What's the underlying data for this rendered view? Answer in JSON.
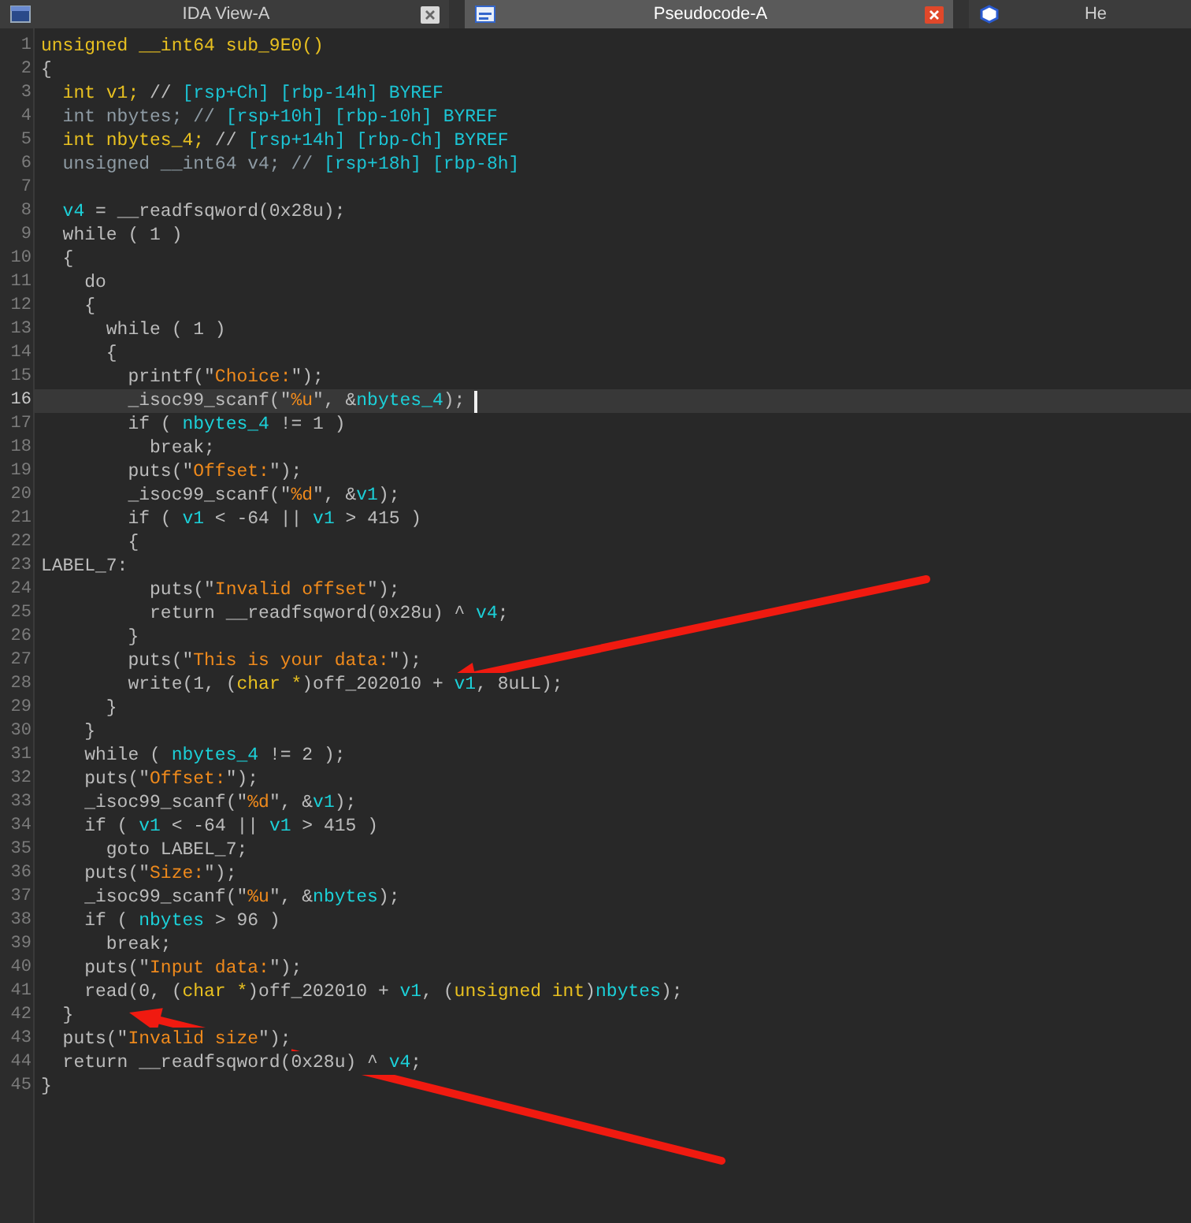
{
  "tabs": [
    {
      "label": "IDA View-A",
      "kind": "disasm",
      "selected": false,
      "closable": true
    },
    {
      "label": "Pseudocode-A",
      "kind": "pseudocode",
      "selected": true,
      "closable": true
    },
    {
      "label": "He",
      "kind": "hex",
      "selected": false,
      "closable": false
    }
  ],
  "code_lines": [
    {
      "number": "1",
      "current": false,
      "tokens": [
        {
          "kind": "type",
          "text": "unsigned __int64 sub_9E0()"
        }
      ]
    },
    {
      "number": "2",
      "current": false,
      "tokens": [
        {
          "kind": "plain",
          "text": "{"
        }
      ]
    },
    {
      "number": "3",
      "current": false,
      "tokens": [
        {
          "kind": "type",
          "text": "  int v1;"
        },
        {
          "kind": "plain",
          "text": " // "
        },
        {
          "kind": "comment",
          "text": "[rsp+Ch] [rbp-14h] BYREF"
        }
      ]
    },
    {
      "number": "4",
      "current": false,
      "tokens": [
        {
          "kind": "dim",
          "text": "  int nbytes; // "
        },
        {
          "kind": "comment",
          "text": "[rsp+10h] [rbp-10h] BYREF"
        }
      ]
    },
    {
      "number": "5",
      "current": false,
      "tokens": [
        {
          "kind": "type",
          "text": "  int nbytes_4;"
        },
        {
          "kind": "plain",
          "text": " // "
        },
        {
          "kind": "comment",
          "text": "[rsp+14h] [rbp-Ch] BYREF"
        }
      ]
    },
    {
      "number": "6",
      "current": false,
      "tokens": [
        {
          "kind": "dim",
          "text": "  unsigned __int64 v4; // "
        },
        {
          "kind": "comment",
          "text": "[rsp+18h] [rbp-8h]"
        }
      ]
    },
    {
      "number": "7",
      "current": false
    },
    {
      "number": "8",
      "current": false,
      "tokens": [
        {
          "kind": "var",
          "text": "  v4"
        },
        {
          "kind": "plain",
          "text": " = __readfsqword(0x28u);"
        }
      ]
    },
    {
      "number": "9",
      "current": false,
      "tokens": [
        {
          "kind": "plain",
          "text": "  while ( 1 )"
        }
      ]
    },
    {
      "number": "10",
      "current": false,
      "tokens": [
        {
          "kind": "plain",
          "text": "  {"
        }
      ]
    },
    {
      "number": "11",
      "current": false,
      "tokens": [
        {
          "kind": "plain",
          "text": "    do"
        }
      ]
    },
    {
      "number": "12",
      "current": false,
      "tokens": [
        {
          "kind": "plain",
          "text": "    {"
        }
      ]
    },
    {
      "number": "13",
      "current": false,
      "tokens": [
        {
          "kind": "plain",
          "text": "      while ( 1 )"
        }
      ]
    },
    {
      "number": "14",
      "current": false,
      "tokens": [
        {
          "kind": "plain",
          "text": "      {"
        }
      ]
    },
    {
      "number": "15",
      "current": false,
      "tokens": [
        {
          "kind": "plain",
          "text": "        printf(\""
        },
        {
          "kind": "string",
          "text": "Choice:"
        },
        {
          "kind": "plain",
          "text": "\");"
        }
      ]
    },
    {
      "number": "16",
      "current": true,
      "tokens": [
        {
          "kind": "plain",
          "text": "        _isoc99_scanf(\""
        },
        {
          "kind": "string",
          "text": "%u"
        },
        {
          "kind": "plain",
          "text": "\", &"
        },
        {
          "kind": "var",
          "text": "nbytes_4"
        },
        {
          "kind": "plain",
          "text": ");"
        }
      ]
    },
    {
      "number": "17",
      "current": false,
      "tokens": [
        {
          "kind": "plain",
          "text": "        if ( "
        },
        {
          "kind": "var",
          "text": "nbytes_4"
        },
        {
          "kind": "plain",
          "text": " != 1 )"
        }
      ]
    },
    {
      "number": "18",
      "current": false,
      "tokens": [
        {
          "kind": "plain",
          "text": "          break;"
        }
      ]
    },
    {
      "number": "19",
      "current": false,
      "tokens": [
        {
          "kind": "plain",
          "text": "        puts(\""
        },
        {
          "kind": "string",
          "text": "Offset:"
        },
        {
          "kind": "plain",
          "text": "\");"
        }
      ]
    },
    {
      "number": "20",
      "current": false,
      "tokens": [
        {
          "kind": "plain",
          "text": "        _isoc99_scanf(\""
        },
        {
          "kind": "string",
          "text": "%d"
        },
        {
          "kind": "plain",
          "text": "\", &"
        },
        {
          "kind": "var",
          "text": "v1"
        },
        {
          "kind": "plain",
          "text": ");"
        }
      ]
    },
    {
      "number": "21",
      "current": false,
      "tokens": [
        {
          "kind": "plain",
          "text": "        if ( "
        },
        {
          "kind": "var",
          "text": "v1"
        },
        {
          "kind": "plain",
          "text": " < -64 || "
        },
        {
          "kind": "var",
          "text": "v1"
        },
        {
          "kind": "plain",
          "text": " > 415 )"
        }
      ]
    },
    {
      "number": "22",
      "current": false,
      "tokens": [
        {
          "kind": "plain",
          "text": "        {"
        }
      ]
    },
    {
      "number": "23",
      "current": false,
      "tokens": [
        {
          "kind": "plain",
          "text": "LABEL_7:"
        }
      ]
    },
    {
      "number": "24",
      "current": false,
      "tokens": [
        {
          "kind": "plain",
          "text": "          puts(\""
        },
        {
          "kind": "string",
          "text": "Invalid offset"
        },
        {
          "kind": "plain",
          "text": "\");"
        }
      ]
    },
    {
      "number": "25",
      "current": false,
      "tokens": [
        {
          "kind": "plain",
          "text": "          return __readfsqword(0x28u) ^ "
        },
        {
          "kind": "var",
          "text": "v4"
        },
        {
          "kind": "plain",
          "text": ";"
        }
      ]
    },
    {
      "number": "26",
      "current": false,
      "tokens": [
        {
          "kind": "plain",
          "text": "        }"
        }
      ]
    },
    {
      "number": "27",
      "current": false,
      "tokens": [
        {
          "kind": "plain",
          "text": "        puts(\""
        },
        {
          "kind": "string",
          "text": "This is your data:"
        },
        {
          "kind": "plain",
          "text": "\");"
        }
      ]
    },
    {
      "number": "28",
      "current": false,
      "tokens": [
        {
          "kind": "plain",
          "text": "        write(1, ("
        },
        {
          "kind": "type",
          "text": "char *"
        },
        {
          "kind": "plain",
          "text": ")off_202010 + "
        },
        {
          "kind": "var",
          "text": "v1"
        },
        {
          "kind": "plain",
          "text": ", 8uLL);"
        }
      ]
    },
    {
      "number": "29",
      "current": false,
      "tokens": [
        {
          "kind": "plain",
          "text": "      }"
        }
      ]
    },
    {
      "number": "30",
      "current": false,
      "tokens": [
        {
          "kind": "plain",
          "text": "    }"
        }
      ]
    },
    {
      "number": "31",
      "current": false,
      "tokens": [
        {
          "kind": "plain",
          "text": "    while ( "
        },
        {
          "kind": "var",
          "text": "nbytes_4"
        },
        {
          "kind": "plain",
          "text": " != 2 );"
        }
      ]
    },
    {
      "number": "32",
      "current": false,
      "tokens": [
        {
          "kind": "plain",
          "text": "    puts(\""
        },
        {
          "kind": "string",
          "text": "Offset:"
        },
        {
          "kind": "plain",
          "text": "\");"
        }
      ]
    },
    {
      "number": "33",
      "current": false,
      "tokens": [
        {
          "kind": "plain",
          "text": "    _isoc99_scanf(\""
        },
        {
          "kind": "string",
          "text": "%d"
        },
        {
          "kind": "plain",
          "text": "\", &"
        },
        {
          "kind": "var",
          "text": "v1"
        },
        {
          "kind": "plain",
          "text": ");"
        }
      ]
    },
    {
      "number": "34",
      "current": false,
      "tokens": [
        {
          "kind": "plain",
          "text": "    if ( "
        },
        {
          "kind": "var",
          "text": "v1"
        },
        {
          "kind": "plain",
          "text": " < -64 || "
        },
        {
          "kind": "var",
          "text": "v1"
        },
        {
          "kind": "plain",
          "text": " > 415 )"
        }
      ]
    },
    {
      "number": "35",
      "current": false,
      "tokens": [
        {
          "kind": "plain",
          "text": "      goto LABEL_7;"
        }
      ]
    },
    {
      "number": "36",
      "current": false,
      "tokens": [
        {
          "kind": "plain",
          "text": "    puts(\""
        },
        {
          "kind": "string",
          "text": "Size:"
        },
        {
          "kind": "plain",
          "text": "\");"
        }
      ]
    },
    {
      "number": "37",
      "current": false,
      "tokens": [
        {
          "kind": "plain",
          "text": "    _isoc99_scanf(\""
        },
        {
          "kind": "string",
          "text": "%u"
        },
        {
          "kind": "plain",
          "text": "\", &"
        },
        {
          "kind": "var",
          "text": "nbytes"
        },
        {
          "kind": "plain",
          "text": ");"
        }
      ]
    },
    {
      "number": "38",
      "current": false,
      "tokens": [
        {
          "kind": "plain",
          "text": "    if ( "
        },
        {
          "kind": "var",
          "text": "nbytes"
        },
        {
          "kind": "plain",
          "text": " > 96 )"
        }
      ]
    },
    {
      "number": "39",
      "current": false,
      "tokens": [
        {
          "kind": "plain",
          "text": "      break;"
        }
      ]
    },
    {
      "number": "40",
      "current": false,
      "tokens": [
        {
          "kind": "plain",
          "text": "    puts(\""
        },
        {
          "kind": "string",
          "text": "Input data:"
        },
        {
          "kind": "plain",
          "text": "\");"
        }
      ]
    },
    {
      "number": "41",
      "current": false,
      "tokens": [
        {
          "kind": "plain",
          "text": "    read(0, ("
        },
        {
          "kind": "type",
          "text": "char *"
        },
        {
          "kind": "plain",
          "text": ")off_202010 + "
        },
        {
          "kind": "var",
          "text": "v1"
        },
        {
          "kind": "plain",
          "text": ", ("
        },
        {
          "kind": "type",
          "text": "unsigned int"
        },
        {
          "kind": "plain",
          "text": ")"
        },
        {
          "kind": "var",
          "text": "nbytes"
        },
        {
          "kind": "plain",
          "text": ");"
        }
      ]
    },
    {
      "number": "42",
      "current": false,
      "tokens": [
        {
          "kind": "plain",
          "text": "  }"
        }
      ]
    },
    {
      "number": "43",
      "current": false,
      "tokens": [
        {
          "kind": "plain",
          "text": "  puts(\""
        },
        {
          "kind": "string",
          "text": "Invalid size"
        },
        {
          "kind": "plain",
          "text": "\");"
        }
      ]
    },
    {
      "number": "44",
      "current": false,
      "tokens": [
        {
          "kind": "plain",
          "text": "  return __readfsqword(0x28u) ^ "
        },
        {
          "kind": "var",
          "text": "v4"
        },
        {
          "kind": "plain",
          "text": ";"
        }
      ]
    },
    {
      "number": "45",
      "current": false,
      "tokens": [
        {
          "kind": "plain",
          "text": "}"
        }
      ]
    }
  ]
}
